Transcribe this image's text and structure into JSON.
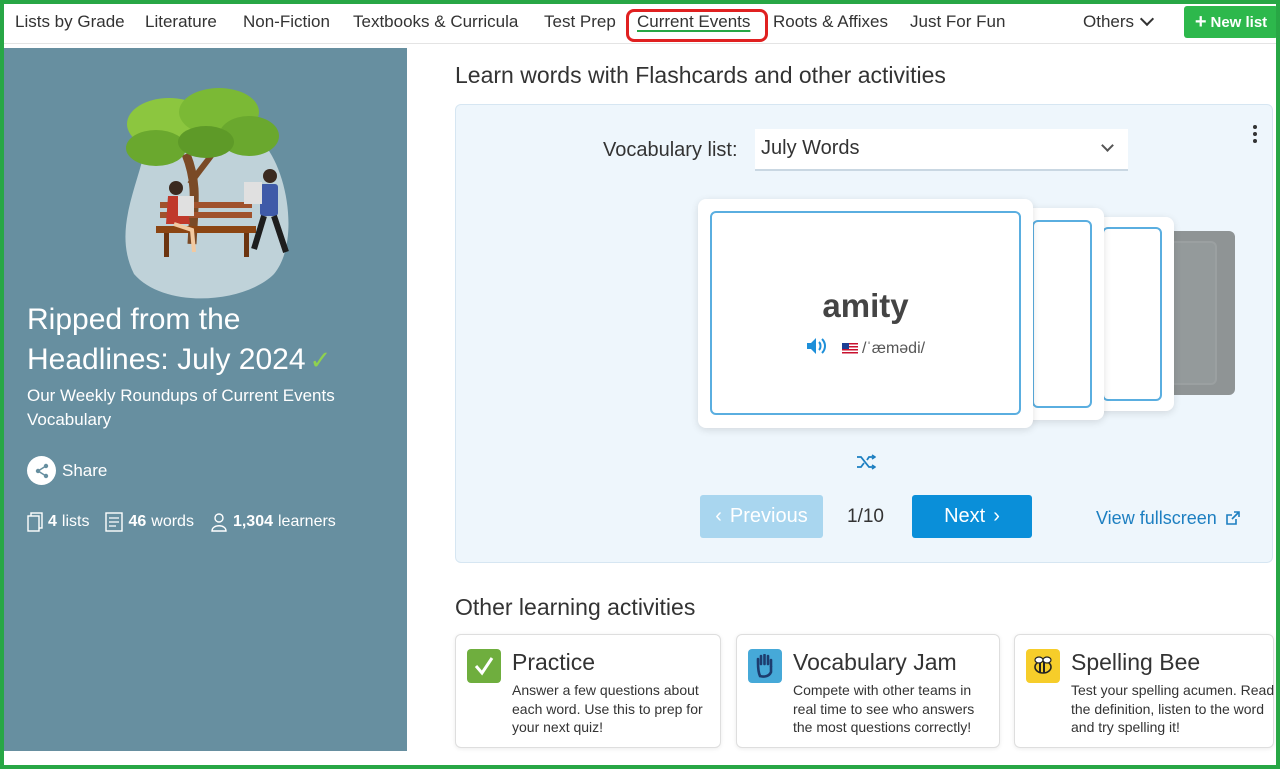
{
  "nav": {
    "items": [
      {
        "label": "Lists by Grade"
      },
      {
        "label": "Literature"
      },
      {
        "label": "Non-Fiction"
      },
      {
        "label": "Textbooks & Curricula"
      },
      {
        "label": "Test Prep"
      },
      {
        "label": "Current Events",
        "active": true
      },
      {
        "label": "Roots & Affixes"
      },
      {
        "label": "Just For Fun"
      }
    ],
    "others_label": "Others",
    "new_list_label": "New list",
    "highlight_color": "#e02020",
    "accent_color": "#28a745"
  },
  "sidebar": {
    "title": "Ripped from the Headlines: July 2024",
    "subtitle": "Our Weekly Roundups of Current Events Vocabulary",
    "share_label": "Share",
    "stats": {
      "lists_count": "4",
      "lists_label": "lists",
      "words_count": "46",
      "words_label": "words",
      "learners_count": "1,304",
      "learners_label": "learners"
    },
    "background_color": "#678fa0"
  },
  "main": {
    "heading": "Learn words with Flashcards and other activities",
    "flashcards": {
      "vocab_label": "Vocabulary list:",
      "selected_list": "July Words",
      "word": "amity",
      "pronunciation": "/ˈæmədi/",
      "previous_label": "Previous",
      "next_label": "Next",
      "page_indicator": "1/10",
      "fullscreen_label": "View fullscreen"
    },
    "other_heading": "Other learning activities",
    "activities": [
      {
        "title": "Practice",
        "description": "Answer a few questions about each word. Use this to prep for your next quiz!",
        "icon": "checkmark-icon",
        "icon_color": "#6fae3e"
      },
      {
        "title": "Vocabulary Jam",
        "description": "Compete with other teams in real time to see who answers the most questions correctly!",
        "icon": "raised-hand-icon",
        "icon_color": "#46a9d8"
      },
      {
        "title": "Spelling Bee",
        "description": "Test your spelling acumen. Read the definition, listen to the word and try spelling it!",
        "icon": "bee-icon",
        "icon_color": "#f6cd2a"
      }
    ]
  }
}
